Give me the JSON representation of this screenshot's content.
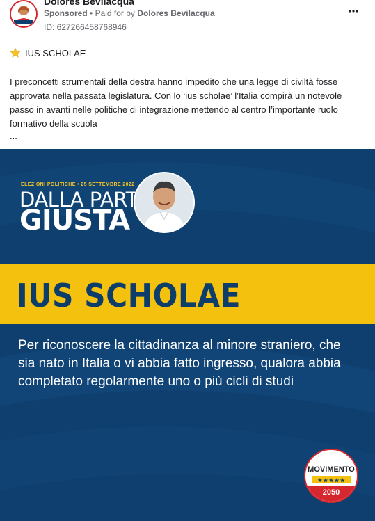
{
  "advertiser": {
    "name": "Dolores Bevilacqua",
    "sponsored_label": "Sponsored",
    "paid_for_prefix": "Paid for by",
    "paid_for_name": "Dolores Bevilacqua",
    "ad_id": "ID: 627266458768946"
  },
  "post": {
    "title_icon": "star-icon",
    "title": "IUS SCHOLAE",
    "body": "I preconcetti strumentali della destra hanno impedito che una legge di civiltà fosse approvata nella passata legislatura. Con lo ‘ius scholae’ l’Italia compirà un notevole passo in avanti nelle politiche di integrazione mettendo al centro l’importante ruolo formativo della scuola",
    "ellipsis": "..."
  },
  "creative": {
    "election_tag": "ELEZIONI POLITICHE • 25 SETTEMBRE 2022",
    "slogan_top": "DALLA PARTE",
    "slogan_bottom": "GIUSTA",
    "headline": "IUS SCHOLAE",
    "description": "Per riconoscere la cittadinanza al minore straniero, che sia nato in Italia o vi abbia fatto ingresso, qualora abbia completato regolarmente uno o più cicli di studi",
    "logo_name": "MOVIMENTO",
    "logo_year": "2050"
  },
  "colors": {
    "navy": "#0e3f6e",
    "yellow": "#f4c10f",
    "red": "#d6262e"
  }
}
